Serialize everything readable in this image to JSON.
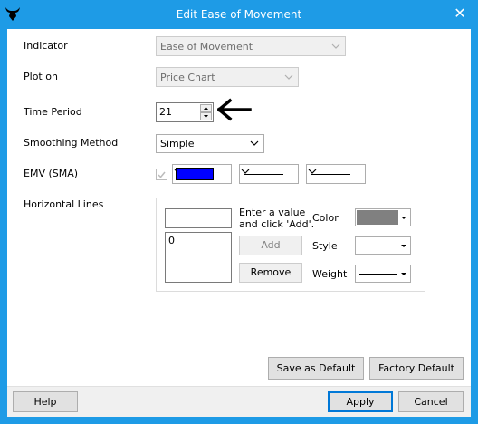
{
  "window": {
    "title": "Edit Ease of Movement",
    "close_glyph": "✕",
    "frame_color": "#1e9be6"
  },
  "form": {
    "indicator_label": "Indicator",
    "indicator_value": "Ease of Movement",
    "plot_on_label": "Plot on",
    "plot_on_value": "Price Chart",
    "time_period_label": "Time Period",
    "time_period_value": "21",
    "smoothing_label": "Smoothing Method",
    "smoothing_value": "Simple",
    "emv_label": "EMV (SMA)",
    "emv_color": "#0000ff",
    "horizontal_lines_label": "Horizontal Lines"
  },
  "hlines": {
    "hint_line1": "Enter a value",
    "hint_line2": "and click 'Add'.",
    "list_items": [
      "0"
    ],
    "add_label": "Add",
    "remove_label": "Remove",
    "color_label": "Color",
    "color_value": "#808080",
    "style_label": "Style",
    "weight_label": "Weight"
  },
  "buttons": {
    "save_default": "Save as Default",
    "factory_default": "Factory Default",
    "help": "Help",
    "apply": "Apply",
    "cancel": "Cancel"
  },
  "icons": {
    "app": "bull-logo-icon",
    "pointer": "arrow-left-icon"
  }
}
